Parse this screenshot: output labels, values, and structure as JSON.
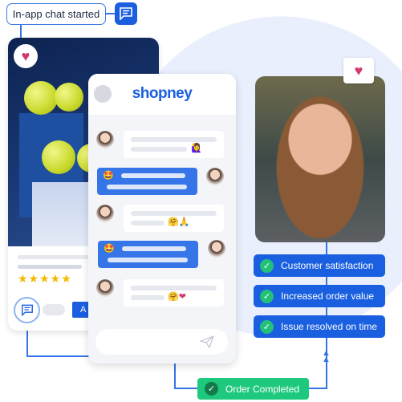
{
  "header": {
    "label": "In-app chat started",
    "icon": "chat-icon"
  },
  "product_card": {
    "favorite_icon": "heart-icon",
    "rating_stars": 5,
    "stars": "★★★★★",
    "button_label": "A",
    "chat_icon": "chat-icon"
  },
  "chat": {
    "brand": "shopney",
    "messages": [
      {
        "side": "left",
        "emoji": "🙋‍♀️"
      },
      {
        "side": "right",
        "emoji": "🤩"
      },
      {
        "side": "left",
        "emoji": "🤗🙏"
      },
      {
        "side": "right",
        "emoji": "🤩"
      },
      {
        "side": "left",
        "emoji": "🤗❤"
      }
    ],
    "send_icon": "send-icon"
  },
  "outcomes": [
    {
      "label": "Customer satisfaction"
    },
    {
      "label": "Increased order value"
    },
    {
      "label": "Issue resolved on time"
    }
  ],
  "order": {
    "label": "Order Completed"
  },
  "colors": {
    "primary": "#1a5fe0",
    "success": "#1ec97e",
    "heart": "#d23a6a"
  }
}
